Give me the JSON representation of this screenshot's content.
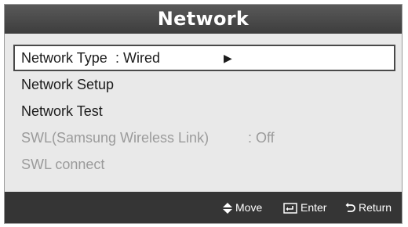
{
  "title": "Network",
  "menu": {
    "items": [
      {
        "label": "Network Type",
        "value": ": Wired",
        "arrow": "▶",
        "state": "selected"
      },
      {
        "label": "Network Setup",
        "state": "normal"
      },
      {
        "label": "Network Test",
        "state": "normal"
      },
      {
        "label": "SWL(Samsung Wireless Link)",
        "value": ": Off",
        "state": "disabled"
      },
      {
        "label": "SWL connect",
        "state": "disabled"
      }
    ]
  },
  "footer": {
    "move": {
      "icon": "up-down-arrows-icon",
      "label": "Move"
    },
    "enter": {
      "icon": "enter-icon",
      "label": "Enter"
    },
    "return": {
      "icon": "return-icon",
      "label": "Return"
    }
  },
  "colors": {
    "title_bar": "#4a4a4a",
    "panel": "#e9e9e9",
    "footer_bar": "#353535",
    "disabled_text": "#9b9b9b"
  }
}
